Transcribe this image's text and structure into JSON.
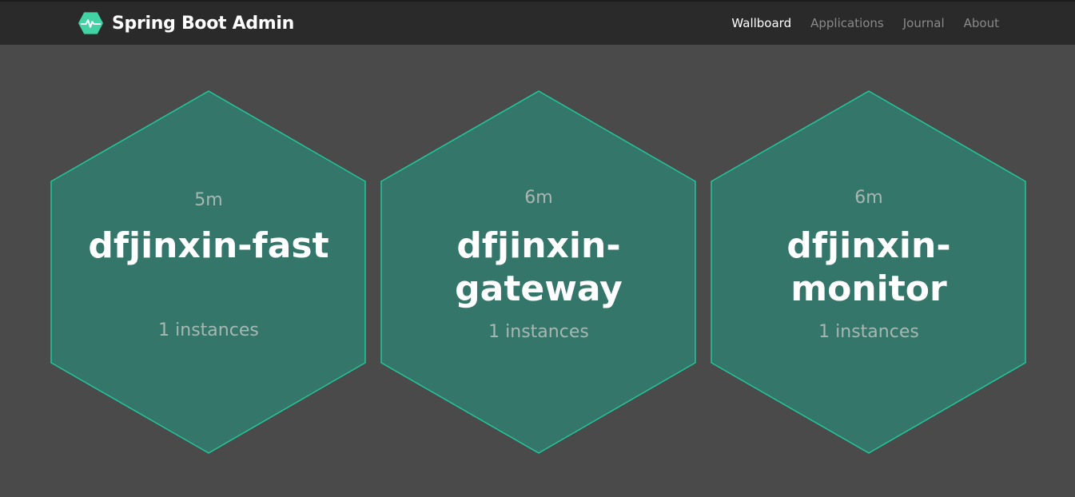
{
  "brand": {
    "title": "Spring Boot Admin",
    "logo_icon": "heartbeat-hexagon-icon",
    "accent": "#42d3a5"
  },
  "nav": {
    "items": [
      {
        "label": "Wallboard",
        "active": true
      },
      {
        "label": "Applications",
        "active": false
      },
      {
        "label": "Journal",
        "active": false
      },
      {
        "label": "About",
        "active": false
      }
    ]
  },
  "colors": {
    "background": "#4a4a4a",
    "navbar": "#2a2a2a",
    "hex_fill": "#35766a",
    "hex_stroke": "#22c79a"
  },
  "applications": [
    {
      "uptime": "5m",
      "name": "dfjinxin-fast",
      "instances": "1 instances",
      "status": "UP"
    },
    {
      "uptime": "6m",
      "name": "dfjinxin-gateway",
      "instances": "1 instances",
      "status": "UP"
    },
    {
      "uptime": "6m",
      "name": "dfjinxin-monitor",
      "instances": "1 instances",
      "status": "UP"
    }
  ]
}
